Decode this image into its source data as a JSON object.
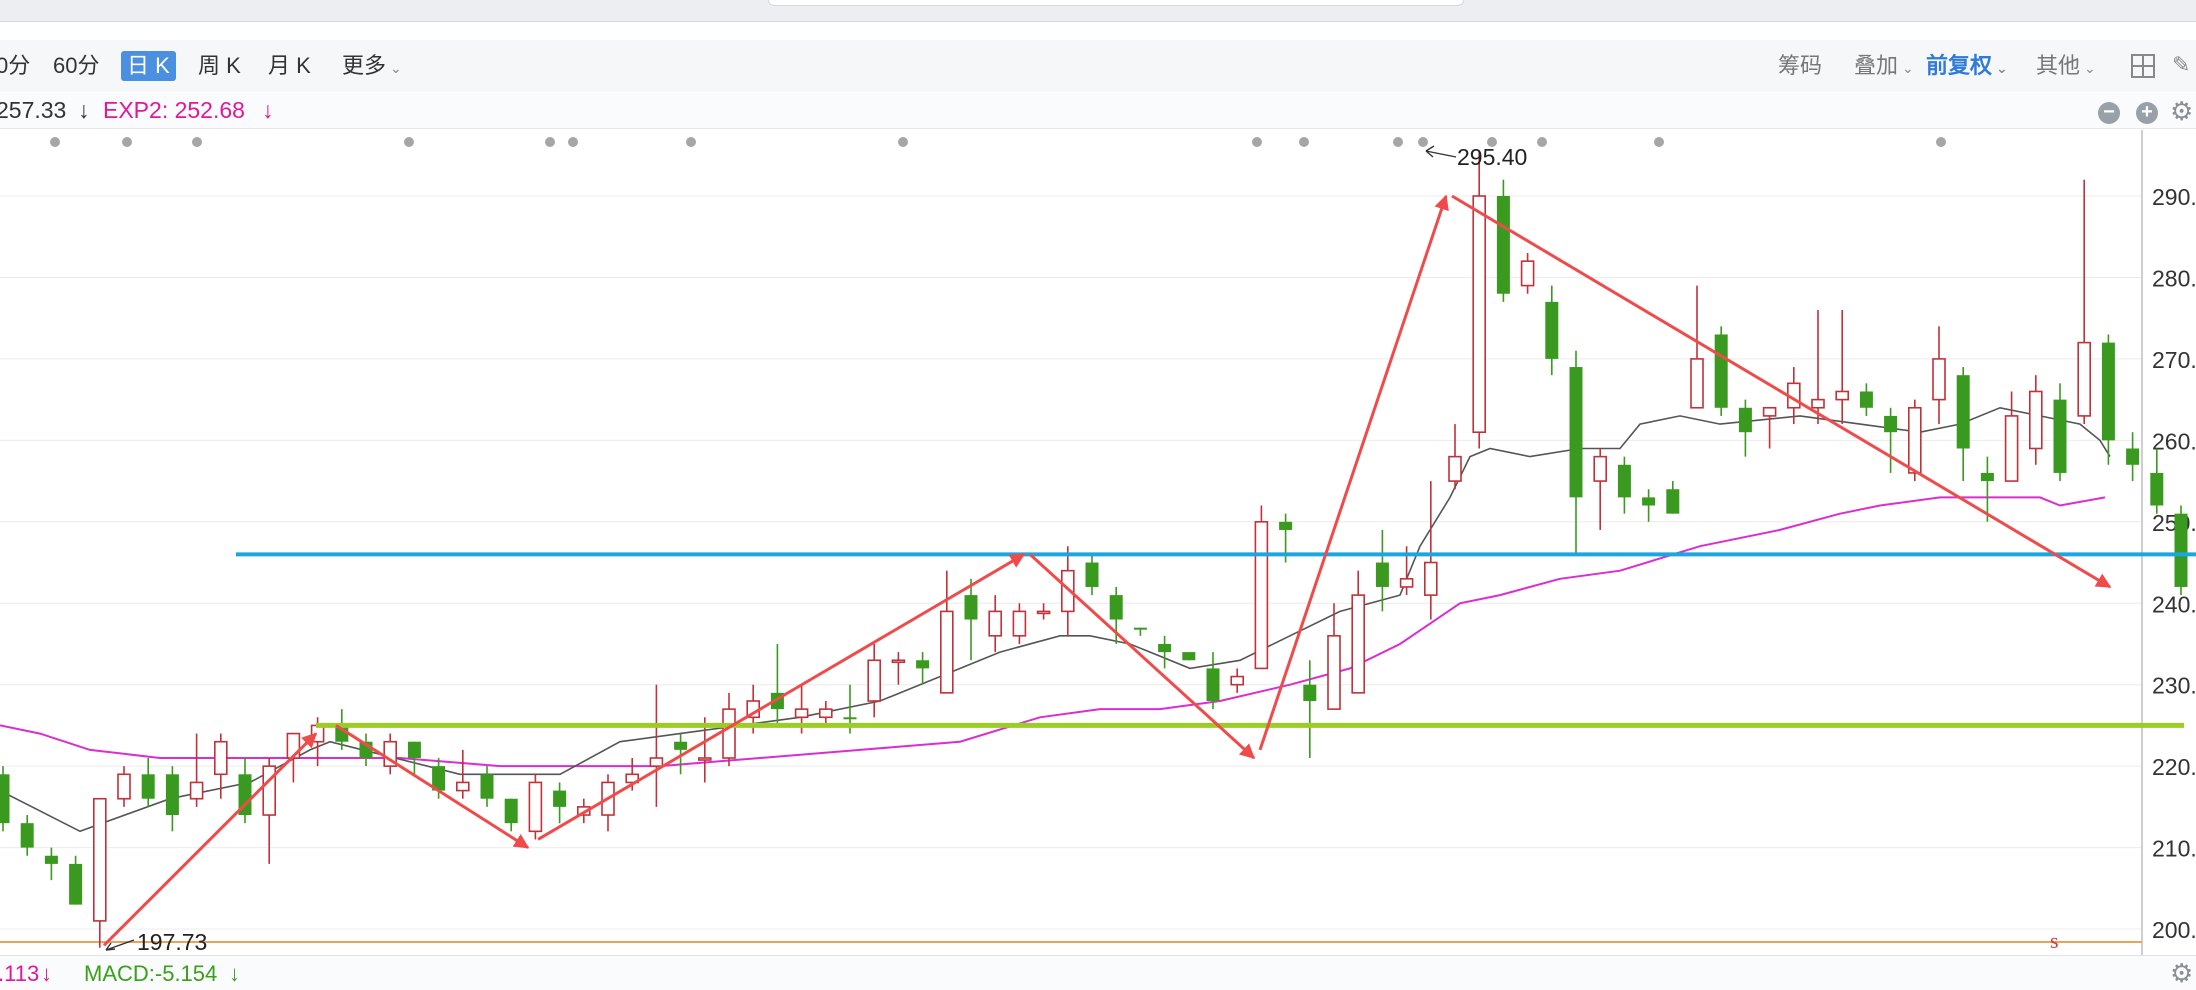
{
  "toolbar": {
    "periods": [
      "0分",
      "60分",
      "日 K",
      "周 K",
      "月 K",
      "更多"
    ],
    "active_period": "日 K",
    "right": {
      "chips": "筹码",
      "overlay": "叠加",
      "adjust": "前复权",
      "other": "其他"
    }
  },
  "indicators": {
    "exp1_partial": "257.33",
    "exp1_arrow": "↓",
    "exp2_label": "EXP2: 252.68",
    "exp2_arrow": "↓",
    "exp2_color": "#e0189a"
  },
  "bottom": {
    "left_partial": ".113",
    "left_arrow": "↓",
    "macd_label": "MACD:-5.154",
    "macd_arrow": "↓",
    "macd_color": "#3aa018"
  },
  "chart_data": {
    "type": "candlestick",
    "y_ticks": [
      "290.",
      "280.",
      "270.",
      "260.",
      "250.",
      "240.",
      "230.",
      "220.",
      "210.",
      "200."
    ],
    "ylim": [
      198,
      300
    ],
    "annotations": {
      "high_label": "295.40",
      "low_label": "197.73",
      "marker": "s"
    },
    "candles": [
      [
        219,
        213,
        220,
        212,
        "dn"
      ],
      [
        213,
        210,
        214,
        209,
        "dn"
      ],
      [
        209,
        208,
        210,
        206,
        "dn"
      ],
      [
        208,
        203,
        209,
        203,
        "dn"
      ],
      [
        201,
        216,
        216,
        197.7,
        "up"
      ],
      [
        216,
        219,
        220,
        215,
        "up"
      ],
      [
        219,
        216,
        221,
        215,
        "dn"
      ],
      [
        219,
        214,
        220,
        212,
        "dn"
      ],
      [
        216,
        218,
        224,
        215,
        "up"
      ],
      [
        219,
        223,
        224,
        216,
        "up"
      ],
      [
        219,
        214,
        221,
        213,
        "dn"
      ],
      [
        214,
        220,
        221,
        208,
        "up"
      ],
      [
        221,
        224,
        224,
        218,
        "up"
      ],
      [
        223,
        225,
        226,
        220,
        "up"
      ],
      [
        225,
        223,
        227,
        222,
        "dn"
      ],
      [
        223,
        221,
        224,
        220,
        "dn"
      ],
      [
        220,
        223,
        224,
        219,
        "up"
      ],
      [
        223,
        221,
        223,
        219,
        "dn"
      ],
      [
        220,
        217,
        221,
        216,
        "dn"
      ],
      [
        217,
        218,
        222,
        216,
        "up"
      ],
      [
        219,
        216,
        220,
        215,
        "dn"
      ],
      [
        216,
        213,
        216,
        212,
        "dn"
      ],
      [
        212,
        218,
        219,
        211,
        "up"
      ],
      [
        217,
        215,
        218,
        213,
        "dn"
      ],
      [
        214,
        215,
        216,
        213,
        "up"
      ],
      [
        214,
        218,
        219,
        212,
        "up"
      ],
      [
        218,
        219,
        221,
        217,
        "up"
      ],
      [
        220,
        221,
        230,
        215,
        "up"
      ],
      [
        223,
        222,
        224,
        219,
        "dn"
      ],
      [
        221,
        221,
        226,
        218,
        "up"
      ],
      [
        221,
        227,
        229,
        220,
        "up"
      ],
      [
        226,
        228,
        230,
        224,
        "up"
      ],
      [
        229,
        227,
        235,
        225,
        "dn"
      ],
      [
        226,
        227,
        230,
        224,
        "up"
      ],
      [
        227,
        226,
        228,
        225,
        "up"
      ],
      [
        226,
        226,
        230,
        224,
        "dn"
      ],
      [
        228,
        233,
        235,
        226,
        "up"
      ],
      [
        233,
        233,
        234,
        230,
        "up"
      ],
      [
        233,
        232,
        234,
        230,
        "dn"
      ],
      [
        229,
        239,
        244,
        229,
        "up"
      ],
      [
        238,
        241,
        243,
        233,
        "dn"
      ],
      [
        239,
        236,
        241,
        234,
        "up"
      ],
      [
        236,
        239,
        240,
        235,
        "up"
      ],
      [
        239,
        239,
        240,
        238,
        "up"
      ],
      [
        239,
        244,
        247,
        236,
        "up"
      ],
      [
        245,
        242,
        246,
        241,
        "dn"
      ],
      [
        241,
        238,
        242,
        235,
        "dn"
      ],
      [
        237,
        237,
        237,
        236,
        "dn"
      ],
      [
        235,
        234,
        236,
        232,
        "dn"
      ],
      [
        234,
        233,
        234,
        233,
        "dn"
      ],
      [
        232,
        228,
        234,
        227,
        "dn"
      ],
      [
        230,
        231,
        232,
        229,
        "up"
      ],
      [
        232,
        250,
        252,
        232,
        "up"
      ],
      [
        250,
        249,
        251,
        245,
        "dn"
      ],
      [
        230,
        228,
        233,
        221,
        "dn"
      ],
      [
        227,
        236,
        240,
        227,
        "up"
      ],
      [
        229,
        241,
        244,
        229,
        "up"
      ],
      [
        245,
        242,
        249,
        239,
        "dn"
      ],
      [
        242,
        243,
        247,
        241,
        "up"
      ],
      [
        241,
        245,
        255,
        238,
        "up"
      ],
      [
        255,
        258,
        262,
        254,
        "up"
      ],
      [
        261,
        290,
        295.4,
        259,
        "up"
      ],
      [
        290,
        278,
        292,
        277,
        "dn"
      ],
      [
        279,
        282,
        283,
        278,
        "up"
      ],
      [
        277,
        270,
        279,
        268,
        "dn"
      ],
      [
        269,
        253,
        271,
        246,
        "dn"
      ],
      [
        255,
        258,
        259,
        249,
        "up"
      ],
      [
        257,
        253,
        258,
        251,
        "dn"
      ],
      [
        253,
        252,
        254,
        250,
        "dn"
      ],
      [
        254,
        251,
        255,
        251,
        "dn"
      ],
      [
        264,
        270,
        279,
        266,
        "up"
      ],
      [
        273,
        264,
        274,
        263,
        "dn"
      ],
      [
        264,
        261,
        265,
        258,
        "dn"
      ],
      [
        263,
        264,
        264,
        259,
        "up"
      ],
      [
        264,
        267,
        269,
        262,
        "up"
      ],
      [
        264,
        265,
        276,
        262,
        "up"
      ],
      [
        265,
        266,
        276,
        262,
        "up"
      ],
      [
        266,
        264,
        267,
        263,
        "dn"
      ],
      [
        263,
        261,
        264,
        256,
        "dn"
      ],
      [
        256,
        264,
        265,
        255,
        "up"
      ],
      [
        265,
        270,
        274,
        262,
        "up"
      ],
      [
        268,
        259,
        269,
        255,
        "dn"
      ],
      [
        256,
        255,
        258,
        250,
        "dn"
      ],
      [
        255,
        263,
        266,
        255,
        "up"
      ],
      [
        259,
        266,
        268,
        257,
        "up"
      ],
      [
        265,
        256,
        267,
        255,
        "dn"
      ],
      [
        263,
        272,
        292,
        262,
        "up"
      ],
      [
        272,
        260,
        273,
        257,
        "dn"
      ],
      [
        259,
        257,
        261,
        255,
        "dn"
      ],
      [
        256,
        252,
        259,
        251,
        "dn"
      ],
      [
        251,
        242,
        252,
        241,
        "dn"
      ]
    ],
    "price_lines": [
      {
        "value": 246,
        "color": "#1aa6df"
      },
      {
        "value": 225,
        "color": "#9ccc27"
      }
    ],
    "ma_short": [
      [
        0,
        217
      ],
      [
        80,
        212
      ],
      [
        170,
        216
      ],
      [
        250,
        218
      ],
      [
        310,
        222
      ],
      [
        330,
        223
      ],
      [
        460,
        219
      ],
      [
        560,
        219
      ],
      [
        620,
        223
      ],
      [
        680,
        224
      ],
      [
        800,
        226
      ],
      [
        880,
        228
      ],
      [
        920,
        230
      ],
      [
        1000,
        234
      ],
      [
        1060,
        236
      ],
      [
        1090,
        236
      ],
      [
        1130,
        235
      ],
      [
        1190,
        232
      ],
      [
        1240,
        233
      ],
      [
        1290,
        236
      ],
      [
        1340,
        239
      ],
      [
        1400,
        241
      ],
      [
        1420,
        247
      ],
      [
        1450,
        253
      ],
      [
        1470,
        258
      ],
      [
        1490,
        259
      ],
      [
        1530,
        258
      ],
      [
        1580,
        259
      ],
      [
        1620,
        259
      ],
      [
        1640,
        262
      ],
      [
        1680,
        263
      ],
      [
        1720,
        262
      ],
      [
        1800,
        263
      ],
      [
        1860,
        262
      ],
      [
        1920,
        261
      ],
      [
        1960,
        262
      ],
      [
        2000,
        264
      ],
      [
        2040,
        263
      ],
      [
        2080,
        262
      ],
      [
        2100,
        260
      ],
      [
        2110,
        258
      ]
    ],
    "ma_long": [
      [
        0,
        225
      ],
      [
        40,
        224
      ],
      [
        90,
        222
      ],
      [
        160,
        221
      ],
      [
        250,
        221
      ],
      [
        320,
        221
      ],
      [
        400,
        221
      ],
      [
        500,
        220
      ],
      [
        600,
        220
      ],
      [
        660,
        220
      ],
      [
        760,
        221
      ],
      [
        860,
        222
      ],
      [
        960,
        223
      ],
      [
        1040,
        226
      ],
      [
        1100,
        227
      ],
      [
        1160,
        227
      ],
      [
        1220,
        228
      ],
      [
        1290,
        230
      ],
      [
        1350,
        232
      ],
      [
        1400,
        235
      ],
      [
        1460,
        240
      ],
      [
        1500,
        241
      ],
      [
        1560,
        243
      ],
      [
        1620,
        244
      ],
      [
        1700,
        247
      ],
      [
        1780,
        249
      ],
      [
        1840,
        251
      ],
      [
        1880,
        252
      ],
      [
        1940,
        253
      ],
      [
        1980,
        253
      ],
      [
        2020,
        253
      ],
      [
        2040,
        253
      ],
      [
        2060,
        252
      ],
      [
        2105,
        253
      ]
    ],
    "swing_arrows": [
      [
        [
          104,
          198
        ],
        [
          316,
          224
        ]
      ],
      [
        [
          336,
          225
        ],
        [
          528,
          210
        ]
      ],
      [
        [
          538,
          211
        ],
        [
          1024,
          246
        ]
      ],
      [
        [
          1030,
          246
        ],
        [
          1254,
          221
        ]
      ],
      [
        [
          1260,
          222
        ],
        [
          1446,
          290
        ]
      ],
      [
        [
          1452,
          290
        ],
        [
          2110,
          242
        ]
      ]
    ],
    "event_dots": [
      55,
      127,
      197,
      409,
      550,
      573,
      691,
      903,
      1257,
      1304,
      1398,
      1423,
      1492,
      1542,
      1659,
      1941
    ]
  }
}
